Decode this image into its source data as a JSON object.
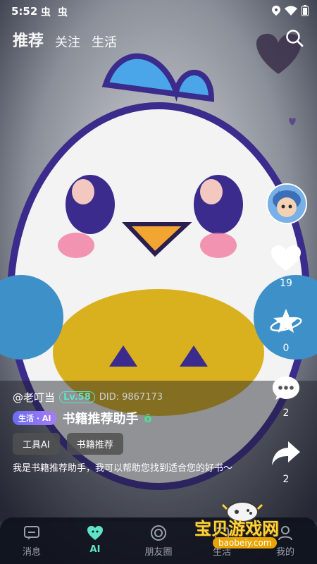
{
  "status": {
    "time": "5:52",
    "app_icon_1": "虫",
    "app_icon_2": "虫"
  },
  "top_tabs": [
    {
      "label": "推荐",
      "active": true
    },
    {
      "label": "关注",
      "active": false
    },
    {
      "label": "生活",
      "active": false
    }
  ],
  "actions": {
    "like_count": "19",
    "favorite_count": "0",
    "comment_count": "2",
    "share_count": "2"
  },
  "post": {
    "username": "@老叮当",
    "level": "Lv.58",
    "did": "DID: 9867173",
    "badge": "生活 · AI",
    "title": "书籍推荐助手",
    "title_mark": "ō",
    "chips": [
      "工具AI",
      "书籍推荐"
    ],
    "description": "我是书籍推荐助手，我可以帮助您找到适合您的好书～"
  },
  "bottom_nav": [
    {
      "label": "消息",
      "icon": "message-icon",
      "active": false
    },
    {
      "label": "AI",
      "icon": "heart-ai-icon",
      "active": true
    },
    {
      "label": "朋友圈",
      "icon": "moments-icon",
      "active": false
    },
    {
      "label": "生活",
      "icon": "life-icon",
      "active": false
    },
    {
      "label": "我的",
      "icon": "profile-icon",
      "active": false
    }
  ],
  "watermark": {
    "text": "宝贝游戏网",
    "url": "baobeiy.com"
  },
  "colors": {
    "accent": "#5fe3c6",
    "badge": "#7b6cf5",
    "nav_bg": "#0f121c"
  }
}
